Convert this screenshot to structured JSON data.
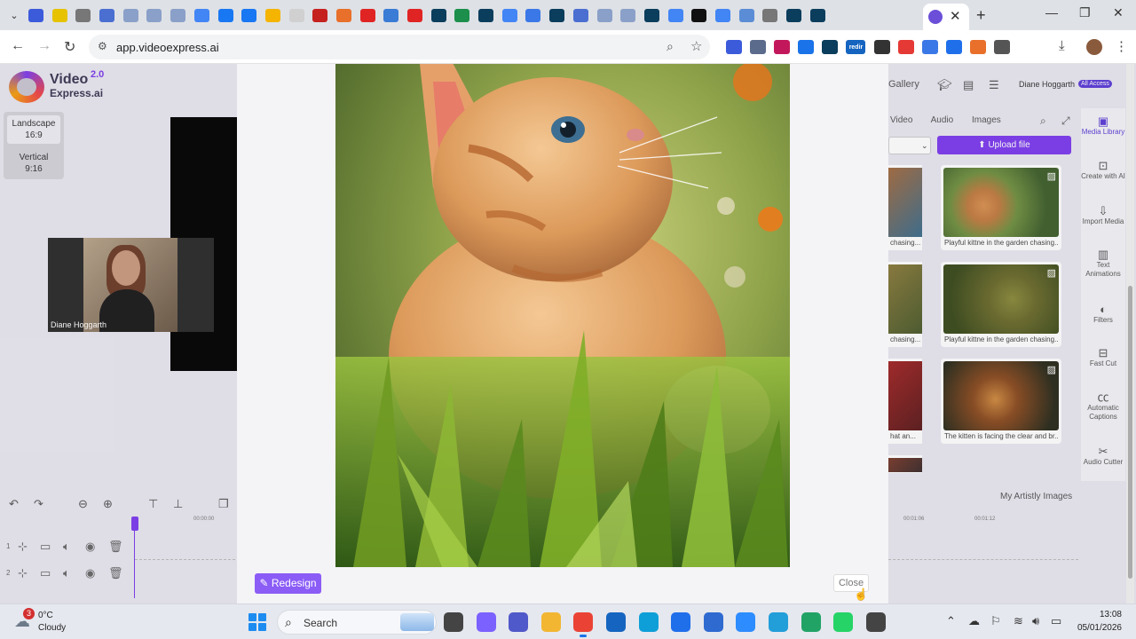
{
  "browser": {
    "tab_icon_colors": [
      "#3b5bdb",
      "#e6c200",
      "#777777",
      "#4a6fd1",
      "#8aa0c8",
      "#8aa0c8",
      "#8aa0c8",
      "#4285f4",
      "#1877f2",
      "#1877f2",
      "#f4b400",
      "#d0d0d0",
      "#c5221f",
      "#e8702a",
      "#e02424",
      "#3a7bd5",
      "#e02424",
      "#0b3d5c",
      "#1b8f4b",
      "#0b3d5c",
      "#4285f4",
      "#3b78e7",
      "#0b3d5c",
      "#4a6fd1",
      "#8aa0c8",
      "#8aa0c8",
      "#0b3d5c",
      "#4285f4",
      "#111111",
      "#4285f4",
      "#5b8dd6",
      "#777777",
      "#0b3d5c",
      "#0b3d5c"
    ],
    "url": "app.videoexpress.ai",
    "ext_icon_colors": [
      "#3b5bdb",
      "#5a6b8c",
      "#c2185b",
      "#1a73e8",
      "#0b3d5c",
      "#1565c0",
      "#333333",
      "#e53935",
      "#3b78e7",
      "#1f6feb",
      "#e8702a",
      "#555555"
    ],
    "ext_redir_label": "redir"
  },
  "app": {
    "logo": {
      "word1": "Video",
      "word2": "Express.ai",
      "version": "2.0"
    },
    "aspect": [
      {
        "label": "Landscape",
        "ratio": "16:9"
      },
      {
        "label": "Vertical",
        "ratio": "9:16"
      }
    ],
    "webcam_name": "Diane Hoggarth",
    "timeline": {
      "time0": "00:00:00",
      "r_time1": "00:01:06",
      "r_time2": "00:01:12",
      "track1": "1",
      "track2": "2"
    },
    "right": {
      "gallery": "Gallery",
      "user_name": "Diane Hoggarth",
      "badge": "All Access",
      "tabs": [
        "Video",
        "Audio",
        "Images"
      ],
      "upload_label": "⬆ Upload file",
      "cards": [
        {
          "caption": "Playful kittne in the garden chasing..."
        },
        {
          "caption": "Playful kittne in the garden chasing..."
        },
        {
          "caption": "The kitten is facing the clear and br..."
        }
      ],
      "partial_captions": [
        "chasing...",
        "chasing...",
        "hat an..."
      ],
      "artisly": "My Artistly Images"
    },
    "rail": [
      {
        "label": "Media Library",
        "icon": "media-library-icon"
      },
      {
        "label": "Create with AI",
        "icon": "robot-icon"
      },
      {
        "label": "Import Media",
        "icon": "import-icon"
      },
      {
        "label": "Text Animations",
        "icon": "text-icon"
      },
      {
        "label": "Filters",
        "icon": "filter-icon"
      },
      {
        "label": "Fast Cut",
        "icon": "briefcase-icon"
      },
      {
        "label": "Automatic Captions",
        "icon": "cc-icon"
      },
      {
        "label": "Audio Cutter",
        "icon": "scissors-icon"
      }
    ]
  },
  "modal": {
    "redesign_label": "✎ Redesign",
    "close_label": "Close",
    "image_subject": "Kitten in grass"
  },
  "taskbar": {
    "weather_badge": "3",
    "temp": "0°C",
    "condition": "Cloudy",
    "search_label": "Search",
    "app_icon_colors": [
      "#444444",
      "#7b61ff",
      "#5059c9",
      "#f2b632",
      "#ea4335",
      "#1565c0",
      "#0e9fd8",
      "#1f6feb",
      "#2f6ad0",
      "#2d8cff",
      "#229ed9",
      "#21a366",
      "#25d366",
      "#444444"
    ],
    "time": "13:08",
    "date": "05/01/2026"
  }
}
